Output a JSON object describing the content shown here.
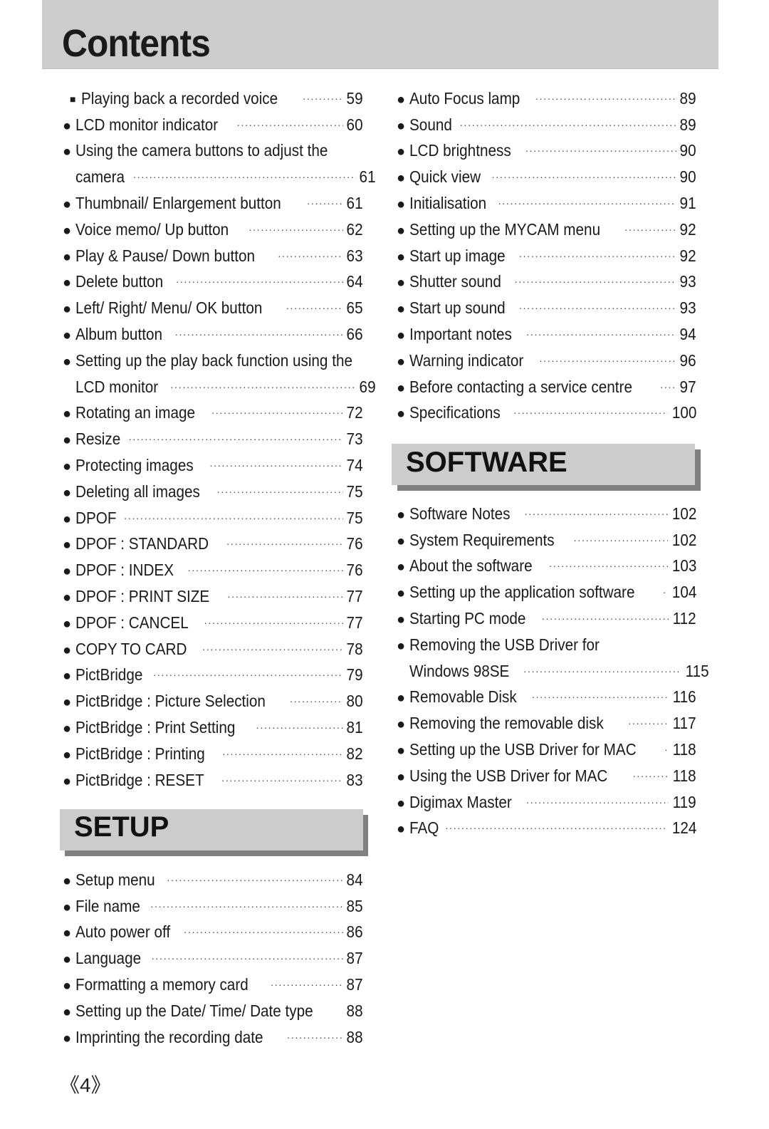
{
  "header": {
    "title": "Contents"
  },
  "left_column": {
    "items": [
      {
        "bullet": "square",
        "label": "Playing back a recorded voice",
        "page": "59"
      },
      {
        "bullet": "circle",
        "label": "LCD monitor indicator",
        "page": "60"
      },
      {
        "bullet": "circle",
        "label": "Using the camera buttons to adjust the",
        "page": ""
      },
      {
        "bullet": "none",
        "label": "camera",
        "page": "61"
      },
      {
        "bullet": "circle",
        "label": "Thumbnail/ Enlargement button",
        "page": "61"
      },
      {
        "bullet": "circle",
        "label": "Voice memo/ Up button",
        "page": "62"
      },
      {
        "bullet": "circle",
        "label": "Play & Pause/ Down button",
        "page": "63"
      },
      {
        "bullet": "circle",
        "label": "Delete button",
        "page": "64"
      },
      {
        "bullet": "circle",
        "label": "Left/ Right/ Menu/ OK button",
        "page": "65"
      },
      {
        "bullet": "circle",
        "label": "Album button",
        "page": "66"
      },
      {
        "bullet": "circle",
        "label": "Setting up the play back function using the",
        "page": ""
      },
      {
        "bullet": "none",
        "label": "LCD monitor",
        "page": "69"
      },
      {
        "bullet": "circle",
        "label": "Rotating an image",
        "page": "72"
      },
      {
        "bullet": "circle",
        "label": "Resize",
        "page": "73"
      },
      {
        "bullet": "circle",
        "label": "Protecting images",
        "page": "74"
      },
      {
        "bullet": "circle",
        "label": "Deleting all images",
        "page": "75"
      },
      {
        "bullet": "circle",
        "label": "DPOF",
        "page": "75"
      },
      {
        "bullet": "circle",
        "label": "DPOF : STANDARD",
        "page": "76"
      },
      {
        "bullet": "circle",
        "label": "DPOF : INDEX",
        "page": "76"
      },
      {
        "bullet": "circle",
        "label": "DPOF : PRINT SIZE",
        "page": "77"
      },
      {
        "bullet": "circle",
        "label": "DPOF : CANCEL",
        "page": "77"
      },
      {
        "bullet": "circle",
        "label": "COPY TO CARD",
        "page": "78"
      },
      {
        "bullet": "circle",
        "label": "PictBridge",
        "page": "79"
      },
      {
        "bullet": "circle",
        "label": "PictBridge : Picture Selection",
        "page": "80"
      },
      {
        "bullet": "circle",
        "label": "PictBridge : Print Setting",
        "page": "81"
      },
      {
        "bullet": "circle",
        "label": "PictBridge : Printing",
        "page": "82"
      },
      {
        "bullet": "circle",
        "label": "PictBridge : RESET",
        "page": "83"
      }
    ]
  },
  "setup_section": {
    "title": "SETUP",
    "items": [
      {
        "bullet": "circle",
        "label": "Setup menu",
        "page": "84"
      },
      {
        "bullet": "circle",
        "label": "File name",
        "page": "85"
      },
      {
        "bullet": "circle",
        "label": "Auto power off",
        "page": "86"
      },
      {
        "bullet": "circle",
        "label": "Language",
        "page": "87"
      },
      {
        "bullet": "circle",
        "label": "Formatting a memory card",
        "page": "87"
      },
      {
        "bullet": "circle",
        "label": "Setting up the Date/ Time/ Date type",
        "page": "88"
      },
      {
        "bullet": "circle",
        "label": "Imprinting the recording date",
        "page": "88"
      }
    ]
  },
  "right_column": {
    "items": [
      {
        "bullet": "circle",
        "label": "Auto Focus lamp",
        "page": "89"
      },
      {
        "bullet": "circle",
        "label": "Sound",
        "page": "89"
      },
      {
        "bullet": "circle",
        "label": "LCD brightness",
        "page": "90"
      },
      {
        "bullet": "circle",
        "label": "Quick view",
        "page": "90"
      },
      {
        "bullet": "circle",
        "label": "Initialisation",
        "page": "91"
      },
      {
        "bullet": "circle",
        "label": "Setting up the MYCAM menu",
        "page": "92"
      },
      {
        "bullet": "circle",
        "label": "Start up image",
        "page": "92"
      },
      {
        "bullet": "circle",
        "label": "Shutter sound",
        "page": "93"
      },
      {
        "bullet": "circle",
        "label": "Start up sound",
        "page": "93"
      },
      {
        "bullet": "circle",
        "label": "Important notes",
        "page": "94"
      },
      {
        "bullet": "circle",
        "label": "Warning indicator",
        "page": "96"
      },
      {
        "bullet": "circle",
        "label": "Before contacting a service centre",
        "page": "97"
      },
      {
        "bullet": "circle",
        "label": "Specifications",
        "page": "100"
      }
    ]
  },
  "software_section": {
    "title": "SOFTWARE",
    "items": [
      {
        "bullet": "circle",
        "label": "Software Notes",
        "page": "102"
      },
      {
        "bullet": "circle",
        "label": "System Requirements",
        "page": "102"
      },
      {
        "bullet": "circle",
        "label": "About the software",
        "page": "103"
      },
      {
        "bullet": "circle",
        "label": "Setting up the application software",
        "page": "104"
      },
      {
        "bullet": "circle",
        "label": "Starting PC mode",
        "page": "112"
      },
      {
        "bullet": "circle",
        "label": "Removing the USB Driver for",
        "page": ""
      },
      {
        "bullet": "none",
        "label": "Windows 98SE",
        "page": "115"
      },
      {
        "bullet": "circle",
        "label": "Removable Disk",
        "page": "116"
      },
      {
        "bullet": "circle",
        "label": "Removing the removable disk",
        "page": "117"
      },
      {
        "bullet": "circle",
        "label": "Setting up the USB Driver for MAC",
        "page": "118"
      },
      {
        "bullet": "circle",
        "label": "Using the USB Driver for MAC",
        "page": "118"
      },
      {
        "bullet": "circle",
        "label": "Digimax Master",
        "page": "119"
      },
      {
        "bullet": "circle",
        "label": "FAQ",
        "page": "124"
      }
    ]
  },
  "footer": {
    "page_number": "《4》"
  },
  "colors": {
    "header_bg": "#cccccc",
    "section_bg": "#cccccc",
    "section_shadow": "#808080",
    "text": "#1a1a1a"
  }
}
